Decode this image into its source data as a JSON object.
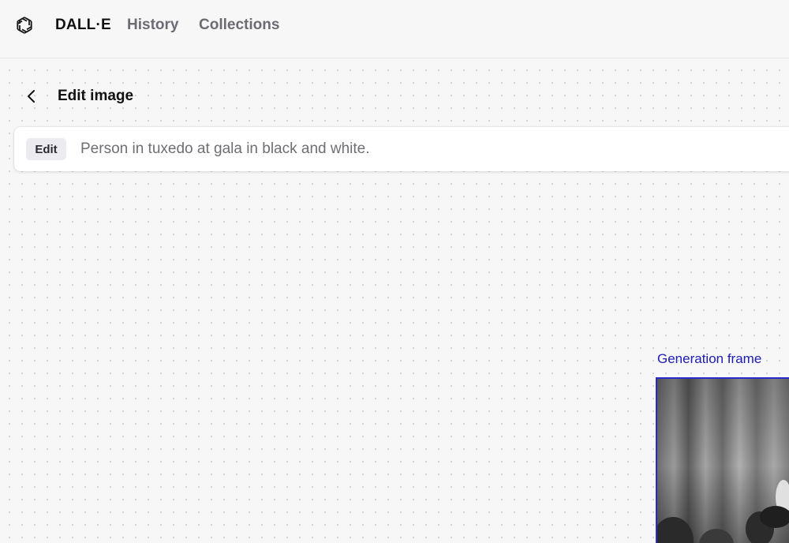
{
  "header": {
    "brand": "DALL·E",
    "nav": [
      {
        "label": "History"
      },
      {
        "label": "Collections"
      }
    ],
    "logo_icon": "openai-logo-icon"
  },
  "page": {
    "title": "Edit image",
    "back_icon": "chevron-left-icon"
  },
  "prompt_bar": {
    "badge": "Edit",
    "text": "Person in tuxedo at gala in black and white."
  },
  "canvas": {
    "frame_label": "Generation frame",
    "frame_color": "#2a2acc",
    "label_color": "#1d1db3"
  }
}
